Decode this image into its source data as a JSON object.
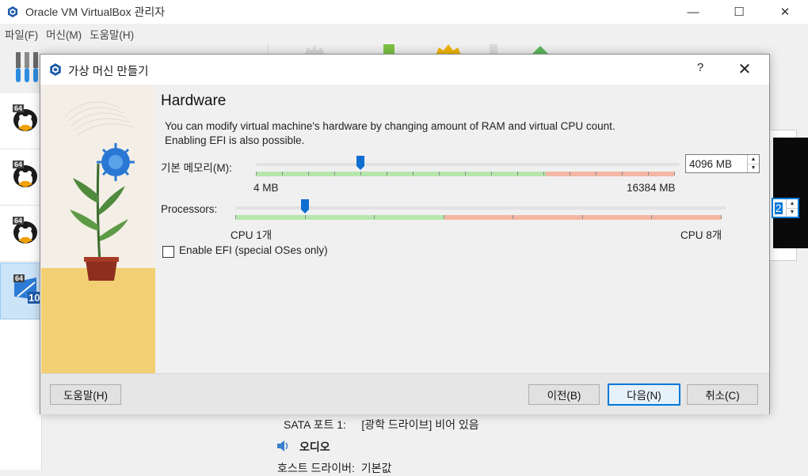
{
  "window": {
    "title": "Oracle VM VirtualBox 관리자",
    "controls": {
      "minimize": "—",
      "maximize": "☐",
      "close": "✕"
    }
  },
  "menu": [
    "파일(F)",
    "머신(M)",
    "도움말(H)"
  ],
  "vm_list": {
    "items": [
      {
        "badge": "64",
        "os_icon": "linux-penguin-icon"
      },
      {
        "badge": "64",
        "os_icon": "linux-penguin-icon"
      },
      {
        "badge": "64",
        "os_icon": "linux-penguin-icon"
      },
      {
        "badge": "64",
        "os_icon": "windows10-icon",
        "overlay": "10",
        "selected": true
      }
    ]
  },
  "details": {
    "sata_line": "SATA 포트 1:     [광학 드라이브] 비어 있음",
    "audio_header": "오디오",
    "audio_line": "호스트 드라이버:  기본값"
  },
  "dialog": {
    "title": "가상 머신 만들기",
    "help_glyph": "?",
    "close_glyph": "✕",
    "heading": "Hardware",
    "description_line1": "You can modify virtual machine's hardware by changing amount of RAM and virtual CPU count.",
    "description_line2": "Enabling EFI is also possible.",
    "memory": {
      "label": "기본 메모리(M):",
      "value": "4096 MB",
      "min_label": "4 MB",
      "max_label": "16384 MB",
      "slider_fraction": 0.25
    },
    "processors": {
      "label": "Processors:",
      "value": "2",
      "min_label": "CPU 1개",
      "max_label": "CPU 8개",
      "slider_fraction": 0.143
    },
    "efi": {
      "label": "Enable EFI (special OSes only)",
      "checked": false
    },
    "buttons": {
      "help": "도움말(H)",
      "back": "이전(B)",
      "next": "다음(N)",
      "cancel": "취소(C)"
    }
  },
  "colors": {
    "accent": "#0078d7",
    "green_band": "#b6e6ad",
    "red_band": "#f2b7a3",
    "selection": "#cce4f7"
  }
}
